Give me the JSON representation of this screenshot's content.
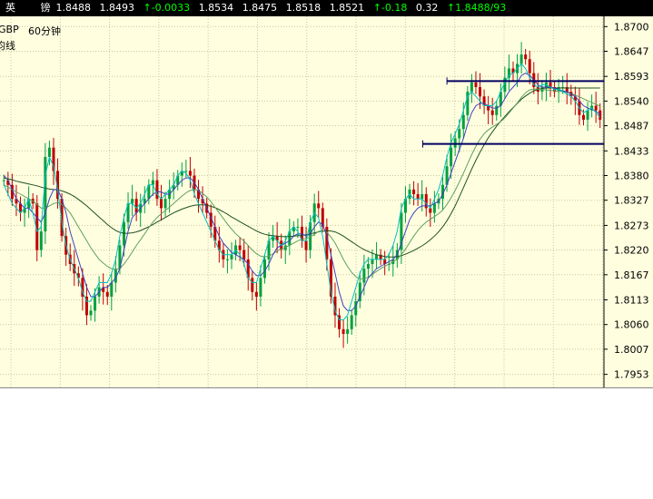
{
  "quote_bar": {
    "name": "英 镑",
    "values": [
      "1.8488",
      "1.8493"
    ],
    "change": "↑-0.0033",
    "values2": [
      "1.8534",
      "1.8475",
      "1.8518",
      "1.8521"
    ],
    "change_pct": "↑-0.18",
    "volume": "0.32",
    "last": "↑1.8488/93"
  },
  "chart_info": {
    "symbol": "GBP",
    "period": "60分钟",
    "subtitle": "均线"
  },
  "colors": {
    "background": "#ffffe0",
    "grid": "#c8c8a0",
    "candle_up": "#00a040",
    "candle_down": "#c00000",
    "ma_short": "#00c0c0",
    "ma_mid": "#4040c0",
    "ma_long": "#60a060",
    "ma_slow": "#205020",
    "support_resistance": "#000060"
  },
  "chart_data": {
    "type": "candlestick",
    "yticks": [
      "1.8700",
      "1.8647",
      "1.8593",
      "1.8540",
      "1.8487",
      "1.8433",
      "1.8380",
      "1.8327",
      "1.8273",
      "1.8220",
      "1.8167",
      "1.8113",
      "1.8060",
      "1.8007",
      "1.7953"
    ],
    "ylim": [
      1.7925,
      1.8722
    ],
    "close_path": [
      1.837,
      1.836,
      1.833,
      1.832,
      1.83,
      1.831,
      1.833,
      1.832,
      1.822,
      1.826,
      1.842,
      1.844,
      1.839,
      1.833,
      1.825,
      1.821,
      1.819,
      1.817,
      1.816,
      1.812,
      1.808,
      1.809,
      1.812,
      1.814,
      1.813,
      1.812,
      1.815,
      1.818,
      1.823,
      1.828,
      1.832,
      1.833,
      1.83,
      1.832,
      1.833,
      1.836,
      1.837,
      1.833,
      1.831,
      1.833,
      1.835,
      1.836,
      1.838,
      1.839,
      1.839,
      1.838,
      1.835,
      1.833,
      1.832,
      1.83,
      1.827,
      1.824,
      1.822,
      1.82,
      1.82,
      1.821,
      1.823,
      1.822,
      1.82,
      1.816,
      1.813,
      1.812,
      1.816,
      1.82,
      1.824,
      1.825,
      1.824,
      1.822,
      1.823,
      1.826,
      1.827,
      1.827,
      1.824,
      1.822,
      1.828,
      1.832,
      1.831,
      1.827,
      1.82,
      1.812,
      1.808,
      1.805,
      1.804,
      1.805,
      1.808,
      1.811,
      1.815,
      1.818,
      1.819,
      1.82,
      1.821,
      1.82,
      1.819,
      1.819,
      1.82,
      1.822,
      1.83,
      1.833,
      1.835,
      1.834,
      1.833,
      1.834,
      1.831,
      1.83,
      1.832,
      1.833,
      1.836,
      1.84,
      1.844,
      1.846,
      1.848,
      1.851,
      1.856,
      1.858,
      1.857,
      1.855,
      1.853,
      1.852,
      1.851,
      1.853,
      1.856,
      1.859,
      1.861,
      1.86,
      1.862,
      1.864,
      1.863,
      1.86,
      1.857,
      1.856,
      1.857,
      1.858,
      1.857,
      1.856,
      1.857,
      1.857,
      1.856,
      1.855,
      1.854,
      1.851,
      1.85,
      1.852,
      1.853,
      1.852,
      1.85
    ],
    "ma_short": [
      1.836,
      1.834,
      1.832,
      1.831,
      1.83,
      1.831,
      1.833,
      1.83,
      1.826,
      1.827,
      1.838,
      1.842,
      1.84,
      1.835,
      1.828,
      1.823,
      1.82,
      1.818,
      1.816,
      1.813,
      1.811,
      1.811,
      1.813,
      1.815,
      1.815,
      1.815,
      1.817,
      1.82,
      1.825,
      1.829,
      1.832,
      1.832,
      1.831,
      1.832,
      1.834,
      1.836,
      1.836,
      1.834,
      1.833,
      1.834,
      1.835,
      1.836,
      1.838,
      1.839,
      1.8385,
      1.837,
      1.834,
      1.832,
      1.83,
      1.828,
      1.826,
      1.824,
      1.822,
      1.821,
      1.821,
      1.821,
      1.822,
      1.821,
      1.819,
      1.816,
      1.815,
      1.815,
      1.818,
      1.821,
      1.824,
      1.825,
      1.824,
      1.823,
      1.824,
      1.826,
      1.827,
      1.826,
      1.824,
      1.824,
      1.828,
      1.83,
      1.829,
      1.825,
      1.819,
      1.813,
      1.809,
      1.807,
      1.807,
      1.808,
      1.811,
      1.814,
      1.817,
      1.819,
      1.82,
      1.82,
      1.82,
      1.82,
      1.82,
      1.821,
      1.823,
      1.826,
      1.831,
      1.833,
      1.834,
      1.833,
      1.833,
      1.833,
      1.832,
      1.831,
      1.833,
      1.835,
      1.838,
      1.842,
      1.845,
      1.847,
      1.849,
      1.852,
      1.855,
      1.856,
      1.855,
      1.854,
      1.853,
      1.853,
      1.853,
      1.854,
      1.856,
      1.858,
      1.8595,
      1.86,
      1.861,
      1.862,
      1.861,
      1.859,
      1.8575,
      1.857,
      1.8575,
      1.8575,
      1.857,
      1.8565,
      1.8565,
      1.856,
      1.8555,
      1.855,
      1.854,
      1.8525,
      1.8515,
      1.852,
      1.8525,
      1.8515,
      1.8505
    ],
    "ma_mid": [
      1.838,
      1.837,
      1.835,
      1.833,
      1.832,
      1.831,
      1.831,
      1.83,
      1.829,
      1.828,
      1.83,
      1.833,
      1.835,
      1.835,
      1.833,
      1.83,
      1.826,
      1.823,
      1.82,
      1.817,
      1.814,
      1.812,
      1.812,
      1.813,
      1.814,
      1.814,
      1.815,
      1.816,
      1.818,
      1.822,
      1.826,
      1.829,
      1.83,
      1.831,
      1.832,
      1.833,
      1.834,
      1.8345,
      1.8345,
      1.834,
      1.834,
      1.835,
      1.836,
      1.837,
      1.8375,
      1.8375,
      1.8365,
      1.835,
      1.833,
      1.831,
      1.829,
      1.827,
      1.825,
      1.8235,
      1.8225,
      1.8215,
      1.821,
      1.8205,
      1.82,
      1.819,
      1.8175,
      1.8165,
      1.8165,
      1.8175,
      1.819,
      1.821,
      1.8225,
      1.823,
      1.8235,
      1.824,
      1.825,
      1.8255,
      1.8255,
      1.825,
      1.8255,
      1.827,
      1.828,
      1.8275,
      1.825,
      1.821,
      1.817,
      1.813,
      1.81,
      1.809,
      1.809,
      1.81,
      1.812,
      1.814,
      1.816,
      1.817,
      1.818,
      1.8185,
      1.819,
      1.8195,
      1.82,
      1.821,
      1.8235,
      1.826,
      1.8285,
      1.83,
      1.831,
      1.8315,
      1.8315,
      1.8315,
      1.832,
      1.8325,
      1.834,
      1.836,
      1.8385,
      1.841,
      1.8435,
      1.846,
      1.849,
      1.8515,
      1.853,
      1.8535,
      1.8535,
      1.853,
      1.8525,
      1.8525,
      1.853,
      1.8545,
      1.856,
      1.857,
      1.858,
      1.8595,
      1.86,
      1.8595,
      1.8585,
      1.8575,
      1.857,
      1.857,
      1.857,
      1.8568,
      1.8565,
      1.8562,
      1.856,
      1.8556,
      1.855,
      1.854,
      1.853,
      1.8525,
      1.8522,
      1.8518,
      1.8512
    ],
    "ma_long": [
      1.836,
      1.8355,
      1.835,
      1.8345,
      1.834,
      1.8335,
      1.833,
      1.8325,
      1.8318,
      1.831,
      1.831,
      1.8315,
      1.832,
      1.8322,
      1.8318,
      1.831,
      1.83,
      1.8285,
      1.827,
      1.8255,
      1.824,
      1.8225,
      1.8212,
      1.82,
      1.8192,
      1.8185,
      1.818,
      1.8178,
      1.818,
      1.819,
      1.8202,
      1.8216,
      1.823,
      1.8242,
      1.8255,
      1.8268,
      1.828,
      1.829,
      1.8298,
      1.8305,
      1.8312,
      1.832,
      1.8328,
      1.8336,
      1.8343,
      1.8348,
      1.835,
      1.8348,
      1.8342,
      1.8334,
      1.8324,
      1.8312,
      1.83,
      1.8288,
      1.8276,
      1.8265,
      1.8255,
      1.8247,
      1.8239,
      1.823,
      1.822,
      1.8212,
      1.8207,
      1.8205,
      1.8207,
      1.8212,
      1.8218,
      1.8222,
      1.8226,
      1.823,
      1.8235,
      1.824,
      1.8243,
      1.8245,
      1.8248,
      1.8254,
      1.826,
      1.8262,
      1.8258,
      1.8248,
      1.8235,
      1.8218,
      1.82,
      1.8185,
      1.8172,
      1.8163,
      1.8158,
      1.8158,
      1.8162,
      1.8168,
      1.8174,
      1.818,
      1.8185,
      1.819,
      1.8195,
      1.82,
      1.821,
      1.8222,
      1.8236,
      1.825,
      1.8262,
      1.8272,
      1.828,
      1.8286,
      1.8292,
      1.8298,
      1.8306,
      1.8318,
      1.8332,
      1.8348,
      1.8366,
      1.8385,
      1.8405,
      1.8425,
      1.8443,
      1.8458,
      1.847,
      1.8478,
      1.8484,
      1.849,
      1.8496,
      1.8504,
      1.8514,
      1.8525,
      1.8536,
      1.8548,
      1.8558,
      1.8564,
      1.8566,
      1.8566,
      1.8565,
      1.8564,
      1.8563,
      1.8562,
      1.8561,
      1.856,
      1.8558,
      1.8556,
      1.8553,
      1.8549,
      1.8545,
      1.8541,
      1.8537,
      1.8533,
      1.8529
    ],
    "ma_slow": [
      1.8375,
      1.8373,
      1.8371,
      1.8368,
      1.8366,
      1.8364,
      1.8362,
      1.836,
      1.8358,
      1.8355,
      1.8353,
      1.8351,
      1.835,
      1.8349,
      1.8347,
      1.8344,
      1.834,
      1.8335,
      1.8329,
      1.8322,
      1.8315,
      1.8307,
      1.8299,
      1.8291,
      1.8283,
      1.8275,
      1.8268,
      1.8262,
      1.8258,
      1.8256,
      1.8256,
      1.8257,
      1.8259,
      1.8262,
      1.8266,
      1.827,
      1.8275,
      1.828,
      1.8285,
      1.829,
      1.8295,
      1.83,
      1.8304,
      1.8308,
      1.8311,
      1.8314,
      1.8316,
      1.8317,
      1.8317,
      1.8316,
      1.8314,
      1.8311,
      1.8307,
      1.8302,
      1.8297,
      1.8291,
      1.8286,
      1.8281,
      1.8276,
      1.8271,
      1.8266,
      1.8261,
      1.8257,
      1.8254,
      1.8252,
      1.8251,
      1.825,
      1.8249,
      1.8249,
      1.8249,
      1.825,
      1.8251,
      1.8252,
      1.8253,
      1.8255,
      1.8257,
      1.8259,
      1.8261,
      1.8262,
      1.8261,
      1.8259,
      1.8255,
      1.825,
      1.8244,
      1.8238,
      1.8232,
      1.8226,
      1.8221,
      1.8217,
      1.8213,
      1.821,
      1.8208,
      1.8206,
      1.8205,
      1.8205,
      1.8206,
      1.8208,
      1.8211,
      1.8215,
      1.8219,
      1.8224,
      1.8229,
      1.8235,
      1.8242,
      1.825,
      1.8259,
      1.827,
      1.8283,
      1.8298,
      1.8315,
      1.8334,
      1.8354,
      1.8374,
      1.8394,
      1.8413,
      1.843,
      1.8446,
      1.8461,
      1.8474,
      1.8486,
      1.8497,
      1.8507,
      1.8517,
      1.8526,
      1.8535,
      1.8544,
      1.8551,
      1.8557,
      1.8562,
      1.8565,
      1.8567,
      1.8568,
      1.8568,
      1.8568,
      1.8568,
      1.8568,
      1.8568,
      1.8568,
      1.8568,
      1.8568,
      1.8568,
      1.8568,
      1.8568,
      1.8568,
      1.8568
    ],
    "hlines": [
      {
        "y": 1.8583,
        "x_from": 0.74,
        "x_to": 1.0
      },
      {
        "y": 1.8448,
        "x_from": 0.7,
        "x_to": 1.0
      }
    ]
  }
}
